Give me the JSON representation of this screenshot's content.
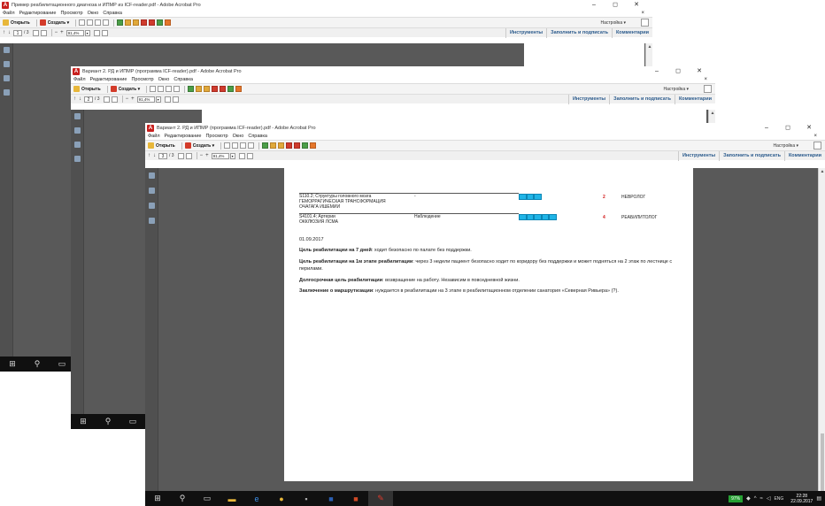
{
  "windows": [
    {
      "title": "Пример реабилитационного диагноза и ИПМР из ICF-reader.pdf - Adobe Acrobat Pro",
      "page_num": "1",
      "total": "/ 3"
    },
    {
      "title": "Вариант 2. РД и ИПМР (программа ICF-reader).pdf - Adobe Acrobat Pro",
      "page_num": "2",
      "total": "/ 3"
    },
    {
      "title": "Вариант 2. РД и ИПМР (программа ICF-reader).pdf - Adobe Acrobat Pro",
      "page_num": "3",
      "total": "/ 3"
    }
  ],
  "menu": [
    "Файл",
    "Редактирование",
    "Просмотр",
    "Окно",
    "Справка"
  ],
  "toolbar": {
    "open": "Открыть",
    "create": "Создать",
    "create_caret": "▾",
    "settings": "Настройка ▾",
    "zoom": "91,4%"
  },
  "right_tabs": [
    "Инструменты",
    "Заполнить и подписать",
    "Комментарии"
  ],
  "window_buttons": {
    "min": "–",
    "max": "◻",
    "close": "✕"
  },
  "document": {
    "rows": [
      {
        "code": "S110.2; Структуры головного мозга",
        "desc1": "ГЕМОРРАГИЧЕСКАЯ ТРАНСФОРМАЦИЯ",
        "desc2": "ОЧАГАГА ИШЕМИИ",
        "col2": "-",
        "level": 3,
        "num": "2",
        "specialist": "НЕВРОЛОГ"
      },
      {
        "code": "S4101.4; Артерии",
        "desc1": "ОККЛЮЗИЯ ЛСМА",
        "desc2": "",
        "col2": "Наблюдение",
        "level": 5,
        "num": "4",
        "specialist": "РЕАБИЛИТОЛОГ"
      }
    ],
    "date": "01.09.2017",
    "p1_label": "Цель реабилитации на 7 дней",
    "p1_text": ": ходит безопасно по палате без поддержки.",
    "p2_label": "Цель реабилитации на 1м этапе реабилитации",
    "p2_text": ": через 3 недели пациент безопасно ходит по коридору без поддержки и может подняться на 2 этаж по лестнице с перилами.",
    "p3_label": "Долгосрочная цель реабилитации",
    "p3_text": ": возвращение на работу. Независим в повседневной жизни.",
    "p4_label": "Заключение о маршрутизации",
    "p4_text": ": нуждается в реабилитации на 3 этапе в реабилитационном отделении санатория «Северная Ривьера» (?)."
  },
  "tray": {
    "battery": "97%",
    "lang": "ENG",
    "time": "22:28",
    "date": "22.09.2017"
  },
  "icons": [
    "acrobat-icon",
    "folder-icon",
    "create-icon",
    "save-icon",
    "print-icon",
    "email-icon",
    "windows-start-icon",
    "search-icon",
    "task-view-icon",
    "file-explorer-icon",
    "edge-icon",
    "chrome-icon",
    "word-icon",
    "powerpoint-icon",
    "acrobat-taskbar-icon"
  ],
  "colors": {
    "accent": "#2a5a8c",
    "level_bar": "#20b4e6",
    "flag_red": "#d21a1a",
    "battery": "#26a033"
  }
}
